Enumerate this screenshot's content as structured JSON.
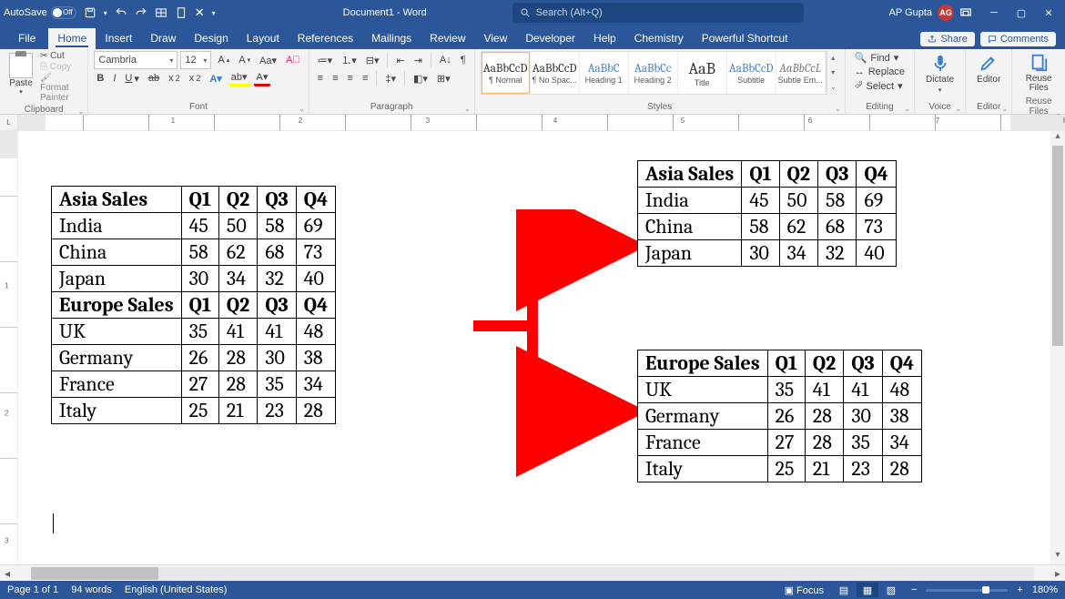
{
  "titlebar": {
    "autosave_label": "AutoSave",
    "doc_title": "Document1 - Word",
    "search_placeholder": "Search (Alt+Q)",
    "user_name": "AP Gupta",
    "user_initials": "AG"
  },
  "tabs": {
    "file": "File",
    "items": [
      "Home",
      "Insert",
      "Draw",
      "Design",
      "Layout",
      "References",
      "Mailings",
      "Review",
      "View",
      "Developer",
      "Help",
      "Chemistry",
      "Powerful Shortcut"
    ],
    "share": "Share",
    "comments": "Comments"
  },
  "ribbon": {
    "clipboard": {
      "paste": "Paste",
      "cut": "Cut",
      "copy": "Copy",
      "format_painter": "Format Painter",
      "label": "Clipboard"
    },
    "font": {
      "name": "Cambria",
      "size": "12",
      "label": "Font"
    },
    "paragraph": {
      "label": "Paragraph"
    },
    "styles": {
      "items": [
        {
          "preview": "AaBbCcD",
          "name": "¶ Normal",
          "selected": true
        },
        {
          "preview": "AaBbCcD",
          "name": "¶ No Spac..."
        },
        {
          "preview": "AaBbC",
          "name": "Heading 1",
          "blue": true
        },
        {
          "preview": "AaBbCc",
          "name": "Heading 2",
          "blue": true
        },
        {
          "preview": "AaB",
          "name": "Title",
          "big": true
        },
        {
          "preview": "AaBbCcD",
          "name": "Subtitle",
          "blue": true
        },
        {
          "preview": "AaBbCcL",
          "name": "Subtle Em...",
          "gray": true
        }
      ],
      "label": "Styles"
    },
    "editing": {
      "find": "Find",
      "replace": "Replace",
      "select": "Select",
      "label": "Editing"
    },
    "voice": {
      "dictate": "Dictate",
      "label": "Voice"
    },
    "editor": {
      "editor": "Editor",
      "label": "Editor"
    },
    "reuse": {
      "reuse": "Reuse Files",
      "label": "Reuse Files"
    }
  },
  "ruler": {
    "nums": [
      "1",
      "2",
      "3",
      "4",
      "5",
      "6",
      "7",
      "8"
    ]
  },
  "vruler": {
    "nums": [
      "1",
      "2",
      "3"
    ]
  },
  "document": {
    "combined": {
      "asia_header": [
        "Asia Sales",
        "Q1",
        "Q2",
        "Q3",
        "Q4"
      ],
      "asia_rows": [
        [
          "India",
          "45",
          "50",
          "58",
          "69"
        ],
        [
          "China",
          "58",
          "62",
          "68",
          "73"
        ],
        [
          "Japan",
          "30",
          "34",
          "32",
          "40"
        ]
      ],
      "europe_header": [
        "Europe Sales",
        "Q1",
        "Q2",
        "Q3",
        "Q4"
      ],
      "europe_rows": [
        [
          "UK",
          "35",
          "41",
          "41",
          "48"
        ],
        [
          "Germany",
          "26",
          "28",
          "30",
          "38"
        ],
        [
          "France",
          "27",
          "28",
          "35",
          "34"
        ],
        [
          "Italy",
          "25",
          "21",
          "23",
          "28"
        ]
      ]
    },
    "asia": {
      "header": [
        "Asia Sales",
        "Q1",
        "Q2",
        "Q3",
        "Q4"
      ],
      "rows": [
        [
          "India",
          "45",
          "50",
          "58",
          "69"
        ],
        [
          "China",
          "58",
          "62",
          "68",
          "73"
        ],
        [
          "Japan",
          "30",
          "34",
          "32",
          "40"
        ]
      ]
    },
    "europe": {
      "header": [
        "Europe Sales",
        "Q1",
        "Q2",
        "Q3",
        "Q4"
      ],
      "rows": [
        [
          "UK",
          "35",
          "41",
          "41",
          "48"
        ],
        [
          "Germany",
          "26",
          "28",
          "30",
          "38"
        ],
        [
          "France",
          "27",
          "28",
          "35",
          "34"
        ],
        [
          "Italy",
          "25",
          "21",
          "23",
          "28"
        ]
      ]
    }
  },
  "statusbar": {
    "page": "Page 1 of 1",
    "words": "94 words",
    "language": "English (United States)",
    "focus": "Focus",
    "zoom": "180%"
  }
}
